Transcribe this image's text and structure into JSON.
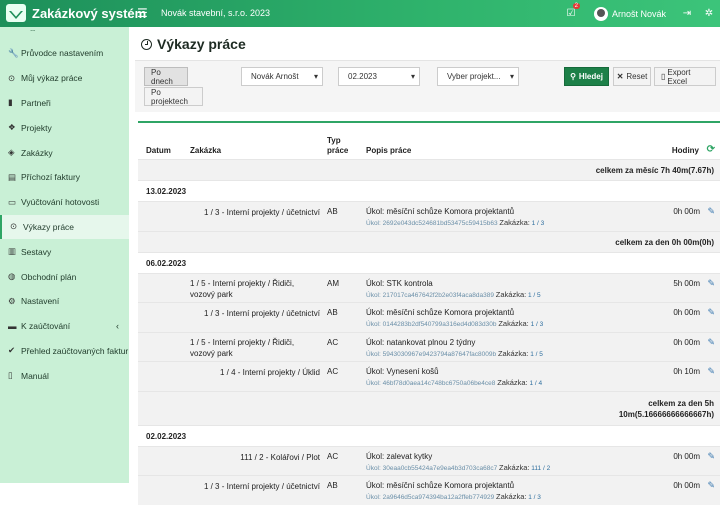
{
  "app": {
    "title": "Zakázkový systém",
    "company": "Novák stavební, s.r.o. 2023",
    "user": "Arnošt Novák",
    "notif_count": "2"
  },
  "sidebar": {
    "items": [
      {
        "label": "Průvodce nastavením",
        "icon": "wrench-icon",
        "glyph": "🔧"
      },
      {
        "label": "Můj výkaz práce",
        "icon": "clock-icon",
        "glyph": "⊙"
      },
      {
        "label": "Partneři",
        "icon": "building-icon",
        "glyph": "▮"
      },
      {
        "label": "Projekty",
        "icon": "cubes-icon",
        "glyph": "❖"
      },
      {
        "label": "Zakázky",
        "icon": "cube-icon",
        "glyph": "◈"
      },
      {
        "label": "Příchozí faktury",
        "icon": "invoice-icon",
        "glyph": "▤"
      },
      {
        "label": "Vyúčtování hotovosti",
        "icon": "cash-icon",
        "glyph": "▭"
      },
      {
        "label": "Výkazy práce",
        "icon": "clock-icon",
        "glyph": "⊙"
      },
      {
        "label": "Sestavy",
        "icon": "chart-icon",
        "glyph": "▥"
      },
      {
        "label": "Obchodní plán",
        "icon": "globe-icon",
        "glyph": "◍"
      },
      {
        "label": "Nastavení",
        "icon": "cogs-icon",
        "glyph": "⚙"
      },
      {
        "label": "K zaúčtování",
        "icon": "folder-icon",
        "glyph": "▬"
      },
      {
        "label": "Přehled zaúčtovaných faktur",
        "icon": "check-circle-icon",
        "glyph": "✔"
      },
      {
        "label": "Manuál",
        "icon": "book-icon",
        "glyph": "▯"
      }
    ]
  },
  "page": {
    "title": "Výkazy práce"
  },
  "filters": {
    "by_days": "Po dnech",
    "by_projects": "Po projektech",
    "user": "Novák Arnošt",
    "period": "02.2023",
    "project_placeholder": "Vyber projekt...",
    "search": "Hledej",
    "reset": "Reset",
    "export": "Export Excel"
  },
  "table": {
    "headers": {
      "date": "Datum",
      "zakazka": "Zakázka",
      "typ1": "Typ",
      "typ2": "práce",
      "popis": "Popis práce",
      "hodiny": "Hodiny"
    }
  },
  "rows": [
    {
      "kind": "total",
      "text": "celkem za měsíc 7h 40m(7.67h)"
    },
    {
      "kind": "date",
      "text": "13.02.2023"
    },
    {
      "kind": "entry",
      "zakazka": "1 / 3 - Interní projekty / účetnictví",
      "typ": "AB",
      "ukol": "Úkol: měsíční schůze Komora projektantů",
      "id": "Úkol: 2692e043dc524681bd53475c59415b63",
      "zk_label": "Zakázka:",
      "zk": "1 / 3",
      "hodiny": "0h 00m"
    },
    {
      "kind": "total",
      "text": "celkem za den 0h 00m(0h)"
    },
    {
      "kind": "date",
      "text": "06.02.2023"
    },
    {
      "kind": "entry",
      "zakazka": "1 / 5 - Interní projekty / Řidiči, vozový park",
      "typ": "AM",
      "ukol": "Úkol: STK kontrola",
      "id": "Úkol: 217017ca467642f2b2e03f4aca8da389",
      "zk_label": "Zakázka:",
      "zk": "1 / 5",
      "hodiny": "5h 00m"
    },
    {
      "kind": "entry",
      "zakazka": "1 / 3 - Interní projekty / účetnictví",
      "typ": "AB",
      "ukol": "Úkol: měsíční schůze Komora projektantů",
      "id": "Úkol: 0144283b2df540799a316ed4d083d30b",
      "zk_label": "Zakázka:",
      "zk": "1 / 3",
      "hodiny": "0h 00m"
    },
    {
      "kind": "entry",
      "zakazka": "1 / 5 - Interní projekty / Řidiči, vozový park",
      "typ": "AC",
      "ukol": "Úkol: natankovat plnou 2 týdny",
      "id": "Úkol: 5943030967e9423794a87647fac8009b",
      "zk_label": "Zakázka:",
      "zk": "1 / 5",
      "hodiny": "0h 00m"
    },
    {
      "kind": "entry",
      "zakazka": "1 / 4 - Interní projekty / Úklid",
      "typ": "AC",
      "ukol": "Úkol: Vynesení košů",
      "id": "Úkol: 46bf78d0aea14c748bc6750a06be4ce8",
      "zk_label": "Zakázka:",
      "zk": "1 / 4",
      "hodiny": "0h 10m"
    },
    {
      "kind": "total2",
      "line1": "celkem za den 5h",
      "line2": "10m(5.16666666666667h)"
    },
    {
      "kind": "date",
      "text": "02.02.2023"
    },
    {
      "kind": "entry",
      "zakazka": "111 / 2 - Kolářovi / Plot",
      "typ": "AC",
      "ukol": "Úkol: zalevat kytky",
      "id": "Úkol: 30eaa0cb55424a7e9ea4b3d703ca68c7",
      "zk_label": "Zakázka:",
      "zk": "111 / 2",
      "hodiny": "0h 00m"
    },
    {
      "kind": "entry",
      "zakazka": "1 / 3 - Interní projekty / účetnictví",
      "typ": "AB",
      "ukol": "Úkol: měsíční schůze Komora projektantů",
      "id": "Úkol: 2a9646d5ca974394ba12a2ffeb774929",
      "zk_label": "Zakázka:",
      "zk": "1 / 3",
      "hodiny": "0h 00m"
    }
  ]
}
